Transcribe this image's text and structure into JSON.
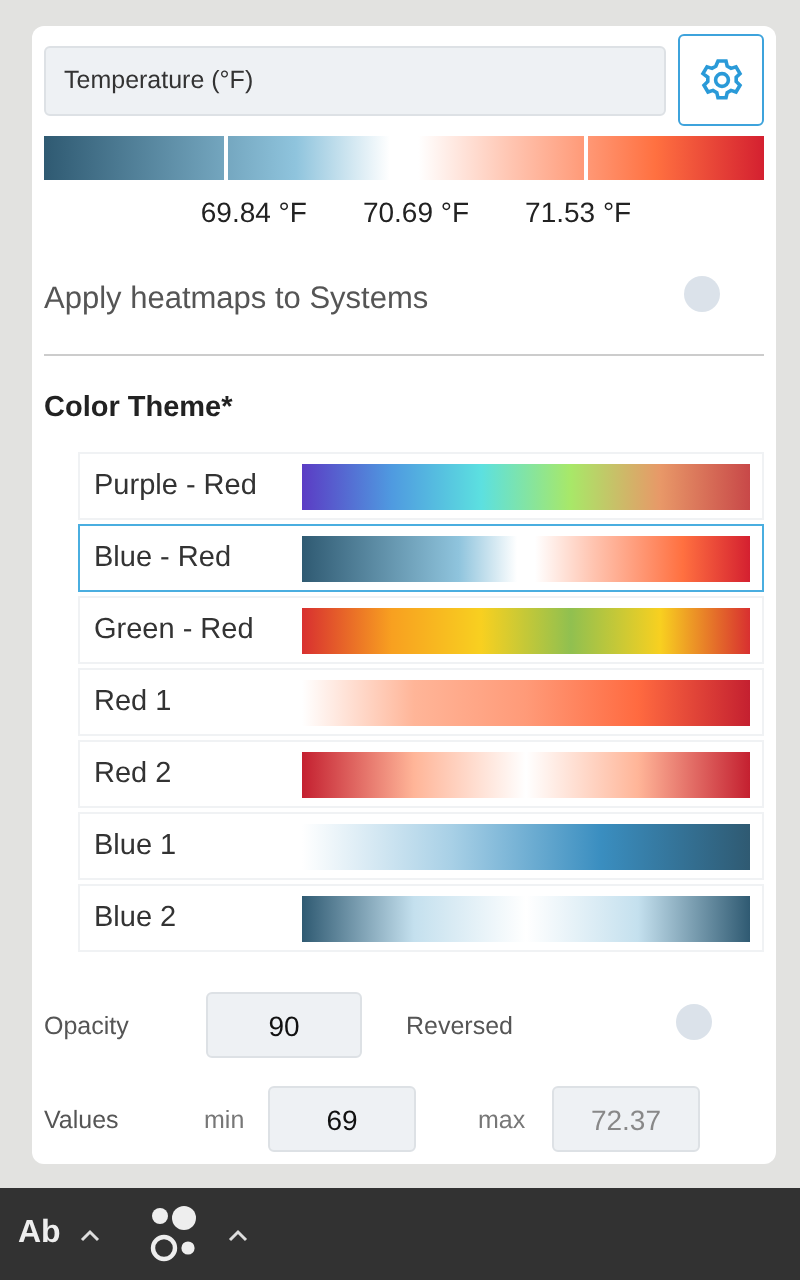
{
  "parameter": {
    "value": "Temperature (°F)"
  },
  "legend": {
    "labels": [
      "69.84 °F",
      "70.69 °F",
      "71.53 °F"
    ]
  },
  "systems_toggle": {
    "label": "Apply heatmaps to Systems",
    "on": false
  },
  "color_theme": {
    "title": "Color Theme*",
    "themes": [
      {
        "label": "Purple - Red",
        "selected": false,
        "kind": "rainbow"
      },
      {
        "label": "Blue - Red",
        "selected": true,
        "kind": "diverging"
      },
      {
        "label": "Green - Red",
        "selected": false,
        "kind": "traffic"
      },
      {
        "label": "Red 1",
        "selected": false,
        "kind": "reds"
      },
      {
        "label": "Red 2",
        "selected": false,
        "kind": "redcentered"
      },
      {
        "label": "Blue 1",
        "selected": false,
        "kind": "blues"
      },
      {
        "label": "Blue 2",
        "selected": false,
        "kind": "bluecentered"
      }
    ]
  },
  "opacity": {
    "label": "Opacity",
    "value": "90",
    "disabled": false
  },
  "reversed": {
    "label": "Reversed",
    "on": false
  },
  "values": {
    "label": "Values",
    "min": {
      "label": "min",
      "value": "69",
      "disabled": false
    },
    "max": {
      "label": "max",
      "placeholder": "72.37"
    }
  },
  "toolbar": {
    "text_tool": "Ab"
  }
}
